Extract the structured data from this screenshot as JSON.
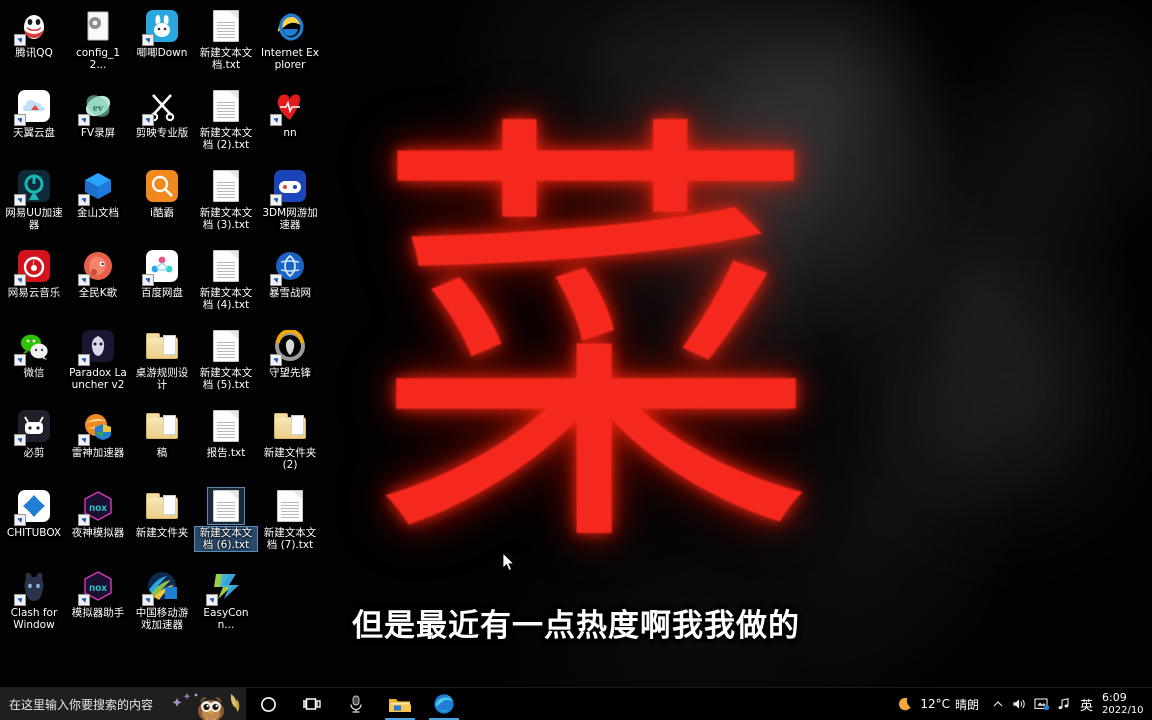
{
  "desktop": {
    "hero_character": "菜",
    "hero_color": "#f4281c",
    "subtitle": "但是最近有一点热度啊我我做的",
    "icons": [
      {
        "label": "腾讯QQ",
        "kind": "app",
        "art": "qq",
        "color1": "#ffffff",
        "color2": "#d93a3a",
        "shortcut": true,
        "selected": false
      },
      {
        "label": "config_12...",
        "kind": "app",
        "art": "config",
        "color1": "#f2f2f2",
        "color2": "#888888",
        "shortcut": false,
        "selected": false
      },
      {
        "label": "唧唧Down",
        "kind": "app",
        "art": "jiji",
        "color1": "#29a8e0",
        "color2": "#ffffff",
        "shortcut": true,
        "selected": false
      },
      {
        "label": "新建文本文档.txt",
        "kind": "file",
        "art": "txt",
        "color1": "#ffffff",
        "color2": "#cccccc",
        "shortcut": false,
        "selected": false
      },
      {
        "label": "Internet Explorer",
        "kind": "app",
        "art": "ie",
        "color1": "#1f7fd4",
        "color2": "#ffd24a",
        "shortcut": false,
        "selected": false
      },
      {
        "label": "天翼云盘",
        "kind": "app",
        "art": "cloud",
        "color1": "#ffffff",
        "color2": "#2f9ce0",
        "shortcut": true,
        "selected": false
      },
      {
        "label": "FV录屏",
        "kind": "app",
        "art": "fv",
        "color1": "#bfe6d8",
        "color2": "#3aa98a",
        "shortcut": true,
        "selected": false
      },
      {
        "label": "剪映专业版",
        "kind": "app",
        "art": "jianying",
        "color1": "#ffffff",
        "color2": "#111111",
        "shortcut": true,
        "selected": false
      },
      {
        "label": "新建文本文档 (2).txt",
        "kind": "file",
        "art": "txt",
        "color1": "#ffffff",
        "color2": "#cccccc",
        "shortcut": false,
        "selected": false
      },
      {
        "label": "nn",
        "kind": "app",
        "art": "nn",
        "color1": "#e21c1c",
        "color2": "#ffffff",
        "shortcut": true,
        "selected": false
      },
      {
        "label": "网易UU加速器",
        "kind": "app",
        "art": "uu",
        "color1": "#0e2a3a",
        "color2": "#19b7b2",
        "shortcut": true,
        "selected": false
      },
      {
        "label": "金山文档",
        "kind": "app",
        "art": "wps",
        "color1": "#1f7ae0",
        "color2": "#2aa3ff",
        "shortcut": true,
        "selected": false
      },
      {
        "label": "i酷霸",
        "kind": "app",
        "art": "search",
        "color1": "#f08a1e",
        "color2": "#ffffff",
        "shortcut": false,
        "selected": false
      },
      {
        "label": "新建文本文档 (3).txt",
        "kind": "file",
        "art": "txt",
        "color1": "#ffffff",
        "color2": "#cccccc",
        "shortcut": false,
        "selected": false
      },
      {
        "label": "3DM网游加速器",
        "kind": "app",
        "art": "game3dm",
        "color1": "#1b44b8",
        "color2": "#ffffff",
        "shortcut": true,
        "selected": false
      },
      {
        "label": "网易云音乐",
        "kind": "app",
        "art": "netease",
        "color1": "#d3131b",
        "color2": "#ffffff",
        "shortcut": true,
        "selected": false
      },
      {
        "label": "全民K歌",
        "kind": "app",
        "art": "ktv",
        "color1": "#e8604c",
        "color2": "#ffffff",
        "shortcut": true,
        "selected": false
      },
      {
        "label": "百度网盘",
        "kind": "app",
        "art": "baidu",
        "color1": "#ffffff",
        "color2": "#2a9df4",
        "shortcut": true,
        "selected": false
      },
      {
        "label": "新建文本文档 (4).txt",
        "kind": "file",
        "art": "txt",
        "color1": "#ffffff",
        "color2": "#cccccc",
        "shortcut": false,
        "selected": false
      },
      {
        "label": "暴雪战网",
        "kind": "app",
        "art": "battlenet",
        "color1": "#1a62c4",
        "color2": "#ffffff",
        "shortcut": true,
        "selected": false
      },
      {
        "label": "微信",
        "kind": "app",
        "art": "wechat",
        "color1": "#2dc100",
        "color2": "#ffffff",
        "shortcut": true,
        "selected": false
      },
      {
        "label": "Paradox Launcher v2",
        "kind": "app",
        "art": "paradox",
        "color1": "#1a1530",
        "color2": "#e8e8e8",
        "shortcut": true,
        "selected": false
      },
      {
        "label": "桌游规则设计",
        "kind": "folder",
        "art": "folder",
        "color1": "#f2dca6",
        "color2": "#d7b565",
        "shortcut": false,
        "selected": false
      },
      {
        "label": "新建文本文档 (5).txt",
        "kind": "file",
        "art": "txt",
        "color1": "#ffffff",
        "color2": "#cccccc",
        "shortcut": false,
        "selected": false
      },
      {
        "label": "守望先锋",
        "kind": "app",
        "art": "overwatch",
        "color1": "#1a1a1a",
        "color2": "#f2a900",
        "shortcut": true,
        "selected": false
      },
      {
        "label": "必剪",
        "kind": "app",
        "art": "bijian",
        "color1": "#20202a",
        "color2": "#ffffff",
        "shortcut": true,
        "selected": false
      },
      {
        "label": "雷神加速器",
        "kind": "app",
        "art": "leishen",
        "color1": "#f08a1e",
        "color2": "#ffffff",
        "shortcut": true,
        "selected": false
      },
      {
        "label": "稿",
        "kind": "folder",
        "art": "folder",
        "color1": "#f2dca6",
        "color2": "#d7b565",
        "shortcut": false,
        "selected": false
      },
      {
        "label": "报告.txt",
        "kind": "file",
        "art": "txt",
        "color1": "#ffffff",
        "color2": "#cccccc",
        "shortcut": false,
        "selected": false
      },
      {
        "label": "新建文件夹 (2)",
        "kind": "folder",
        "art": "folder",
        "color1": "#f2dca6",
        "color2": "#d7b565",
        "shortcut": false,
        "selected": false
      },
      {
        "label": "CHITUBOX",
        "kind": "app",
        "art": "chitubox",
        "color1": "#ffffff",
        "color2": "#1f7fd4",
        "shortcut": true,
        "selected": false
      },
      {
        "label": "夜神模拟器",
        "kind": "app",
        "art": "nox",
        "color1": "#1a1030",
        "color2": "#22d3d3",
        "shortcut": true,
        "selected": false
      },
      {
        "label": "新建文件夹",
        "kind": "folder",
        "art": "folder",
        "color1": "#f2dca6",
        "color2": "#d7b565",
        "shortcut": false,
        "selected": false
      },
      {
        "label": "新建文本文档 (6).txt",
        "kind": "file",
        "art": "txt",
        "color1": "#ffffff",
        "color2": "#cccccc",
        "shortcut": false,
        "selected": true
      },
      {
        "label": "新建文本文档 (7).txt",
        "kind": "file",
        "art": "txt",
        "color1": "#ffffff",
        "color2": "#cccccc",
        "shortcut": false,
        "selected": false
      },
      {
        "label": "Clash for Windows....",
        "kind": "app",
        "art": "clash",
        "color1": "#1c2230",
        "color2": "#8fb4e0",
        "shortcut": true,
        "selected": false
      },
      {
        "label": "模拟器助手",
        "kind": "app",
        "art": "nox",
        "color1": "#1a1030",
        "color2": "#22d3d3",
        "shortcut": true,
        "selected": false
      },
      {
        "label": "中国移动游戏加速器",
        "kind": "app",
        "art": "cmcc",
        "color1": "#1f7fd4",
        "color2": "#8bc34a",
        "shortcut": true,
        "selected": false
      },
      {
        "label": "EasyConn...",
        "kind": "app",
        "art": "easyconn",
        "color1": "#9ccc48",
        "color2": "#3fb0e8",
        "shortcut": true,
        "selected": false
      }
    ]
  },
  "taskbar": {
    "search": {
      "placeholder": "在这里输入你要搜索的内容",
      "value": "",
      "decoration_icon": "owl-illustration"
    },
    "buttons": [
      {
        "name": "cortana",
        "icon": "circle-icon",
        "running": false
      },
      {
        "name": "task-view",
        "icon": "task-view-icon",
        "running": false
      },
      {
        "name": "recorder",
        "icon": "microphone-icon",
        "running": false
      },
      {
        "name": "file-explorer",
        "icon": "folder-icon",
        "running": true
      },
      {
        "name": "edge",
        "icon": "edge-icon",
        "running": true
      }
    ],
    "tray": {
      "weather_icon": "crescent-moon-icon",
      "temperature": "12°C",
      "condition": "晴朗",
      "overflow_icon": "chevron-up-icon",
      "volume_icon": "speaker-icon",
      "network_icon": "network-icon",
      "music_icon": "music-note-icon",
      "ime_label": "英",
      "time": "6:09",
      "date": "2022/10"
    }
  }
}
